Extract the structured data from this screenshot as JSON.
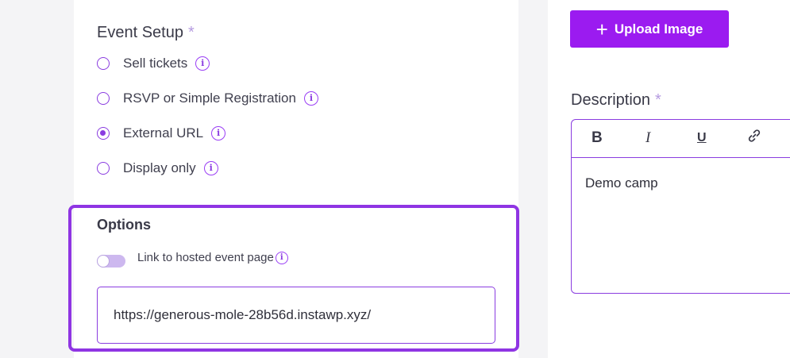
{
  "event_setup": {
    "title": "Event Setup",
    "required_mark": "*",
    "options": [
      {
        "label": "Sell tickets",
        "checked": false
      },
      {
        "label": "RSVP or Simple Registration",
        "checked": false
      },
      {
        "label": "External URL",
        "checked": true
      },
      {
        "label": "Display only",
        "checked": false
      }
    ]
  },
  "options_section": {
    "title": "Options",
    "toggle_label": "Link to hosted event page",
    "toggle_on": false,
    "url_value": "https://generous-mole-28b56d.instawp.xyz/"
  },
  "upload": {
    "icon": "plus-icon",
    "plus_glyph": "+",
    "label": "Upload Image"
  },
  "description": {
    "label": "Description",
    "required_mark": "*",
    "toolbar": {
      "bold": "B",
      "italic": "I",
      "underline": "U",
      "link_icon": "link-icon"
    },
    "content": "Demo camp"
  },
  "colors": {
    "accent": "#9b1bf0",
    "highlight_border": "#8f35e3",
    "radio": "#8a3ce0"
  }
}
